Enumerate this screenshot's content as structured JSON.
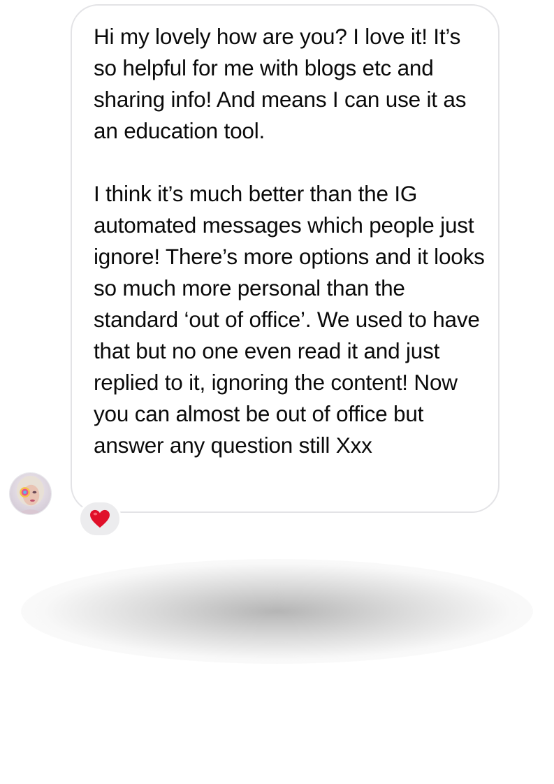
{
  "conversation": {
    "message": {
      "paragraphs": [
        "Hi my lovely how are you? I love it! It’s so helpful for me with blogs etc and sharing info! And means I can use it as an education tool.",
        "I think it’s much better than the IG automated messages which people just ignore! There’s more options and it looks so much more personal than the standard ‘out of office’. We used to have that but no one even read it and just replied to it, ignoring the content! Now you can almost be out of office but answer any question still Xxx"
      ],
      "reaction": "❤️"
    }
  },
  "icons": {
    "avatar": "sender-avatar-icon",
    "reaction": "heart-icon"
  },
  "colors": {
    "bubble_border": "#e3e3e6",
    "text": "#0a0a0a",
    "reaction_bg": "#ececee",
    "heart": "#e0102a"
  }
}
